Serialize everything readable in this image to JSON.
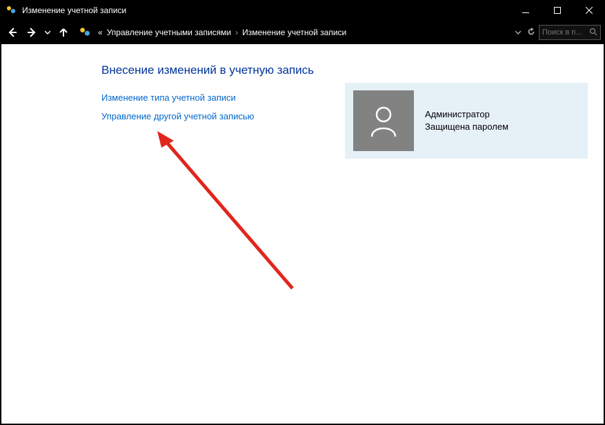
{
  "titlebar": {
    "title": "Изменение учетной записи"
  },
  "breadcrumb": {
    "prefix": "«",
    "item1": "Управление учетными записями",
    "item2": "Изменение учетной записи"
  },
  "search": {
    "placeholder": "Поиск в п..."
  },
  "page": {
    "heading": "Внесение изменений в учетную запись",
    "action_change_type": "Изменение типа учетной записи",
    "action_manage_other": "Управление другой учетной записью"
  },
  "user": {
    "role": "Администратор",
    "protection": "Защищена паролем"
  }
}
